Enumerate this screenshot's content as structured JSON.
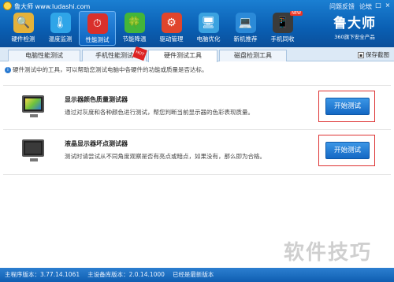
{
  "window": {
    "title": "鲁大师 www.ludashi.com",
    "header_links": [
      "问题反馈",
      "论坛"
    ],
    "controls": [
      "—",
      "□",
      "×"
    ]
  },
  "toolbar": {
    "items": [
      {
        "label": "硬件检测",
        "icon": "magnifier-chip-icon",
        "color": "#e4b23a",
        "glyph": "🔍"
      },
      {
        "label": "温度监测",
        "icon": "thermometer-icon",
        "color": "#2fa5e8",
        "glyph": "🌡"
      },
      {
        "label": "性能测试",
        "icon": "gauge-icon",
        "color": "#d9302b",
        "glyph": "⏱",
        "active": true
      },
      {
        "label": "节能降温",
        "icon": "leaf-icon",
        "color": "#43b53a",
        "glyph": "🍀"
      },
      {
        "label": "驱动管理",
        "icon": "driver-icon",
        "color": "#e0452c",
        "glyph": "⚙"
      },
      {
        "label": "电脑优化",
        "icon": "monitor-optimize-icon",
        "color": "#3aa2e0",
        "glyph": "🖥"
      },
      {
        "label": "新机推荐",
        "icon": "computer-recommend-icon",
        "color": "#2b8ad8",
        "glyph": "💻"
      },
      {
        "label": "手机同收",
        "icon": "phone-icon",
        "color": "#3b3b3b",
        "glyph": "📱",
        "badge": "NEW"
      }
    ],
    "brand_name": "鲁大师",
    "brand_sub": "360旗下安全产品"
  },
  "tabs": {
    "items": [
      {
        "label": "电脑性能测试"
      },
      {
        "label": "手机性能测试",
        "badge": "HOT"
      },
      {
        "label": "硬件测试工具",
        "active": true
      },
      {
        "label": "磁盘检测工具"
      }
    ],
    "save_screenshot": "保存截图"
  },
  "info": {
    "text": "硬件测试中的工具，可以帮助您测试电脑中各硬件的功能或质量是否达标。"
  },
  "tools": [
    {
      "name": "显示器颜色质量测试器",
      "desc": "通过对灰度和各种颜色进行测试，帮您判断当前显示器的色彩表现质量。",
      "button": "开始测试",
      "icon": "color-monitor-icon"
    },
    {
      "name": "液晶显示器坏点测试器",
      "desc": "测试时请尝试从不同角度观察是否有亮点或暗点，如果没有，那么即为合格。",
      "button": "开始测试",
      "icon": "lcd-monitor-icon"
    }
  ],
  "status": {
    "items": [
      "主程序版本：3.77.14.1061",
      "主设备库版本：2.0.14.1000",
      "已经是最新版本"
    ]
  },
  "watermark": "软件技巧"
}
